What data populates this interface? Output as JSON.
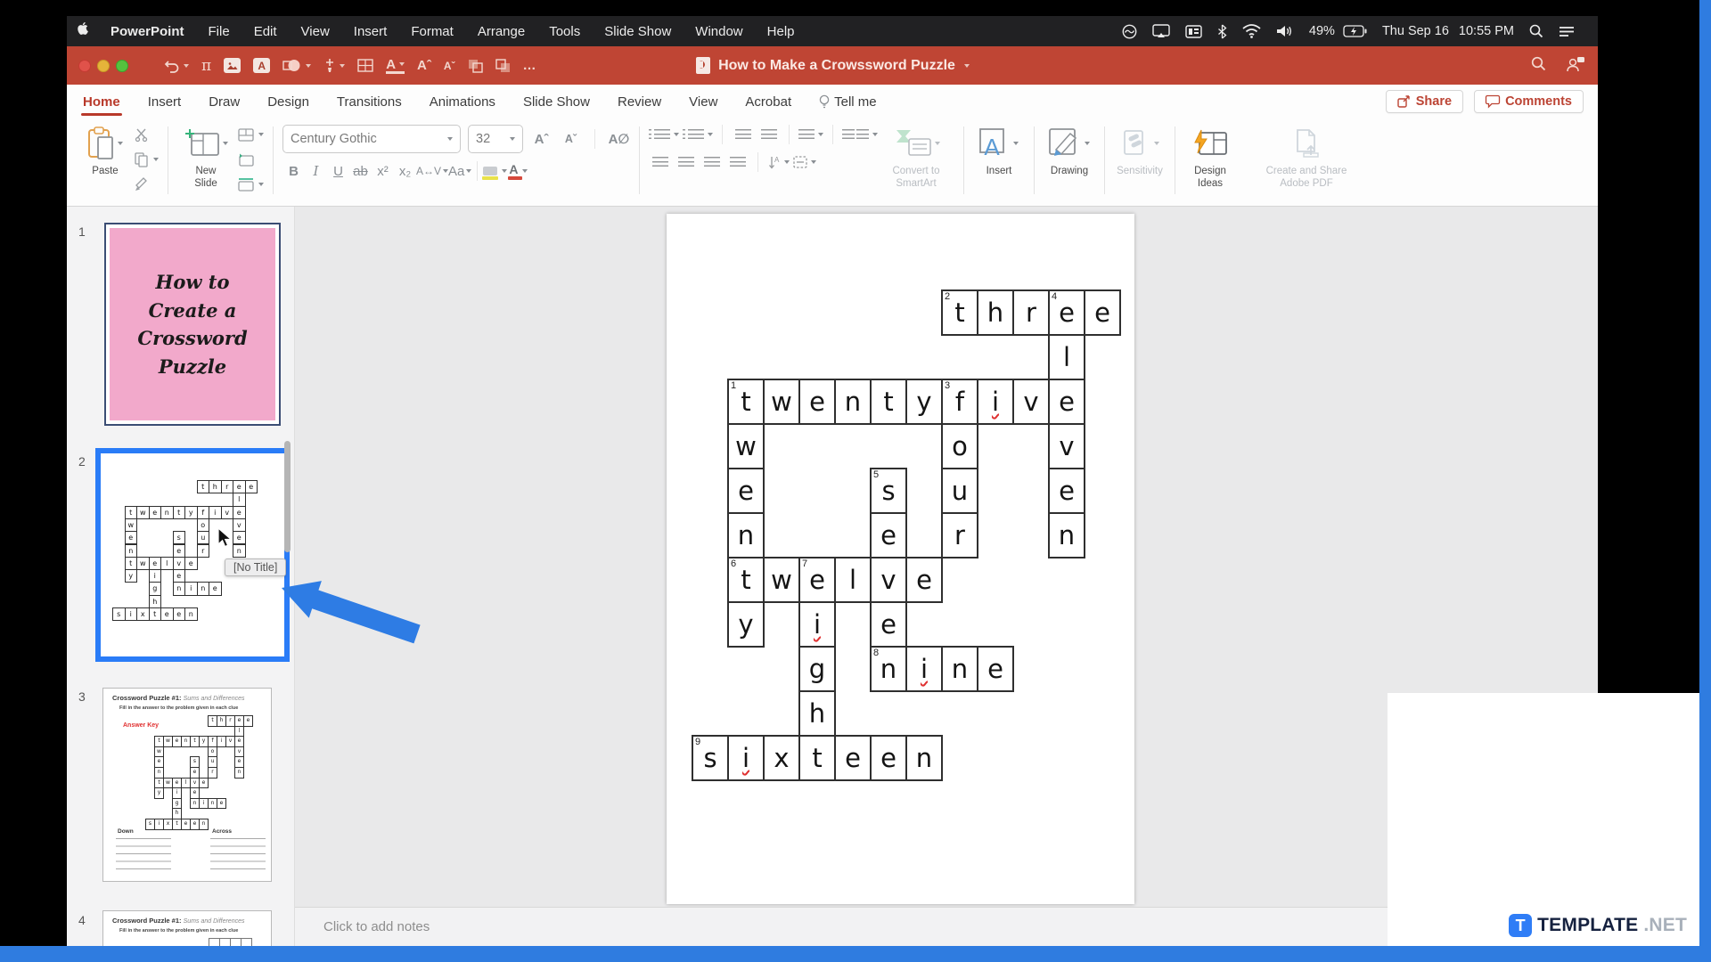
{
  "menubar": {
    "items": [
      "PowerPoint",
      "File",
      "Edit",
      "View",
      "Insert",
      "Format",
      "Arrange",
      "Tools",
      "Slide Show",
      "Window",
      "Help"
    ],
    "battery_percent": "49%",
    "date": "Thu Sep 16",
    "time": "10:55 PM"
  },
  "titlebar": {
    "title": "How to Make a Crowssword Puzzle"
  },
  "ribbon": {
    "tabs": [
      "Home",
      "Insert",
      "Draw",
      "Design",
      "Transitions",
      "Animations",
      "Slide Show",
      "Review",
      "View",
      "Acrobat",
      "Tell me"
    ],
    "active_tab": "Home",
    "share_label": "Share",
    "comments_label": "Comments",
    "paste_label": "Paste",
    "new_slide_label": "New Slide",
    "font_name": "Century Gothic",
    "font_size": "32",
    "bold": "B",
    "italic": "I",
    "underline": "U",
    "strike": "ab",
    "convert_smartart_line1": "Convert to",
    "convert_smartart_line2": "SmartArt",
    "insert_label": "Insert",
    "drawing_label": "Drawing",
    "sensitivity_label": "Sensitivity",
    "design_ideas_line1": "Design",
    "design_ideas_line2": "Ideas",
    "adobe_line1": "Create and Share",
    "adobe_line2": "Adobe PDF"
  },
  "thumbnails": {
    "slide1": {
      "number": "1",
      "lines": [
        "How to",
        "Create a",
        "Crossword",
        "Puzzle"
      ]
    },
    "slide2": {
      "number": "2"
    },
    "slide3": {
      "number": "3",
      "title": "Crossword Puzzle #1:",
      "subtitle": "Sums and Differences",
      "instruction": "Fill in the answer to the problem given in each clue",
      "answer_key": "Answer Key",
      "down_label": "Down",
      "across_label": "Across"
    },
    "slide4": {
      "number": "4",
      "title": "Crossword Puzzle #1:",
      "subtitle": "Sums and Differences",
      "instruction": "Fill in the answer to the problem given in each clue"
    }
  },
  "tooltip_text": "[No Title]",
  "notes_placeholder": "Click to add notes",
  "watermark": {
    "badge": "T",
    "name": "TEMPLATE",
    "net": ".NET"
  },
  "colors": {
    "titlebar_red": "#bf4534",
    "active_tab_red": "#b8392a",
    "selection_blue": "#2a7cf7",
    "annotation_arrow_blue": "#2e7ce4",
    "slide1_pink": "#f2a9cb",
    "answer_key_red": "#e03131",
    "frame_blue": "#2f7ce0"
  },
  "crossword": {
    "words_across": [
      "three",
      "twentyfive",
      "twelve",
      "nine",
      "sixteen"
    ],
    "words_down": [
      "twenty",
      "four",
      "eleven",
      "seven",
      "eight"
    ],
    "cells": [
      {
        "c": 7,
        "r": 0,
        "ch": "t",
        "n": "2"
      },
      {
        "c": 8,
        "r": 0,
        "ch": "h"
      },
      {
        "c": 9,
        "r": 0,
        "ch": "r"
      },
      {
        "c": 10,
        "r": 0,
        "ch": "e",
        "n": "4"
      },
      {
        "c": 11,
        "r": 0,
        "ch": "e"
      },
      {
        "c": 10,
        "r": 1,
        "ch": "l"
      },
      {
        "c": 1,
        "r": 2,
        "ch": "t",
        "n": "1"
      },
      {
        "c": 2,
        "r": 2,
        "ch": "w"
      },
      {
        "c": 3,
        "r": 2,
        "ch": "e"
      },
      {
        "c": 4,
        "r": 2,
        "ch": "n"
      },
      {
        "c": 5,
        "r": 2,
        "ch": "t"
      },
      {
        "c": 6,
        "r": 2,
        "ch": "y"
      },
      {
        "c": 7,
        "r": 2,
        "ch": "f",
        "n": "3"
      },
      {
        "c": 8,
        "r": 2,
        "ch": "i",
        "sq": true
      },
      {
        "c": 9,
        "r": 2,
        "ch": "v"
      },
      {
        "c": 10,
        "r": 2,
        "ch": "e"
      },
      {
        "c": 1,
        "r": 3,
        "ch": "w"
      },
      {
        "c": 7,
        "r": 3,
        "ch": "o"
      },
      {
        "c": 10,
        "r": 3,
        "ch": "v"
      },
      {
        "c": 1,
        "r": 4,
        "ch": "e"
      },
      {
        "c": 5,
        "r": 4,
        "ch": "s",
        "n": "5"
      },
      {
        "c": 7,
        "r": 4,
        "ch": "u"
      },
      {
        "c": 10,
        "r": 4,
        "ch": "e"
      },
      {
        "c": 1,
        "r": 5,
        "ch": "n"
      },
      {
        "c": 5,
        "r": 5,
        "ch": "e"
      },
      {
        "c": 7,
        "r": 5,
        "ch": "r"
      },
      {
        "c": 10,
        "r": 5,
        "ch": "n"
      },
      {
        "c": 1,
        "r": 6,
        "ch": "t",
        "n": "6"
      },
      {
        "c": 2,
        "r": 6,
        "ch": "w"
      },
      {
        "c": 3,
        "r": 6,
        "ch": "e",
        "n": "7"
      },
      {
        "c": 4,
        "r": 6,
        "ch": "l"
      },
      {
        "c": 5,
        "r": 6,
        "ch": "v"
      },
      {
        "c": 6,
        "r": 6,
        "ch": "e"
      },
      {
        "c": 1,
        "r": 7,
        "ch": "y"
      },
      {
        "c": 3,
        "r": 7,
        "ch": "i",
        "sq": true
      },
      {
        "c": 5,
        "r": 7,
        "ch": "e"
      },
      {
        "c": 3,
        "r": 8,
        "ch": "g"
      },
      {
        "c": 5,
        "r": 8,
        "ch": "n",
        "n": "8"
      },
      {
        "c": 6,
        "r": 8,
        "ch": "i",
        "sq": true
      },
      {
        "c": 7,
        "r": 8,
        "ch": "n"
      },
      {
        "c": 8,
        "r": 8,
        "ch": "e"
      },
      {
        "c": 3,
        "r": 9,
        "ch": "h"
      },
      {
        "c": 0,
        "r": 10,
        "ch": "s",
        "n": "9"
      },
      {
        "c": 1,
        "r": 10,
        "ch": "i",
        "sq": true
      },
      {
        "c": 2,
        "r": 10,
        "ch": "x"
      },
      {
        "c": 3,
        "r": 10,
        "ch": "t"
      },
      {
        "c": 4,
        "r": 10,
        "ch": "e"
      },
      {
        "c": 5,
        "r": 10,
        "ch": "e"
      },
      {
        "c": 6,
        "r": 10,
        "ch": "n"
      }
    ]
  }
}
